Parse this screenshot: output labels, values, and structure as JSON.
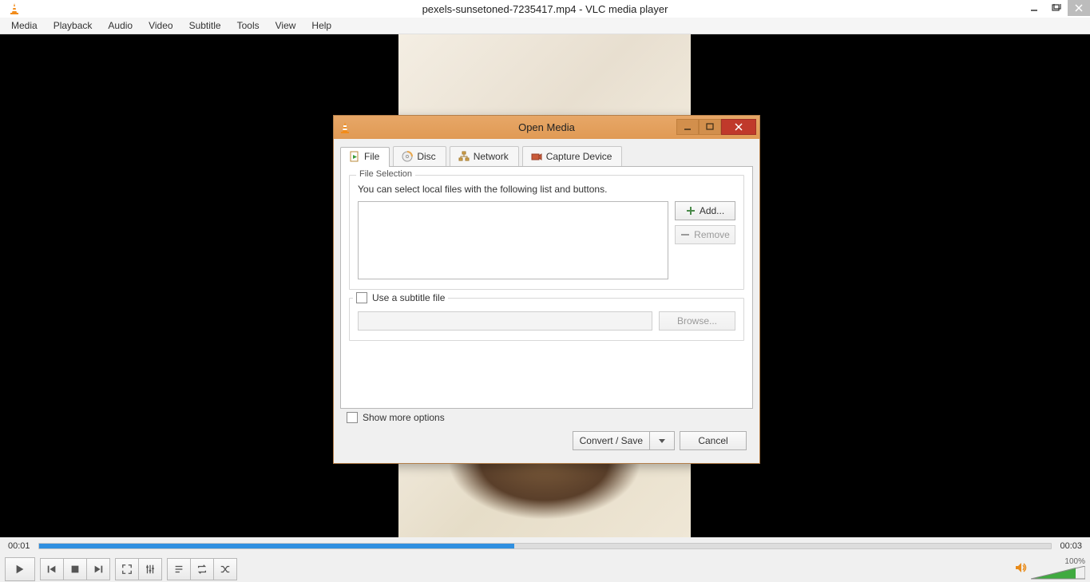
{
  "window": {
    "title": "pexels-sunsetoned-7235417.mp4 - VLC media player"
  },
  "menubar": {
    "items": [
      "Media",
      "Playback",
      "Audio",
      "Video",
      "Subtitle",
      "Tools",
      "View",
      "Help"
    ]
  },
  "playback": {
    "time_current": "00:01",
    "time_total": "00:03",
    "volume_percent": "100%"
  },
  "dialog": {
    "title": "Open Media",
    "tabs": {
      "file": "File",
      "disc": "Disc",
      "network": "Network",
      "capture": "Capture Device"
    },
    "file_group": {
      "legend": "File Selection",
      "help": "You can select local files with the following list and buttons.",
      "add": "Add...",
      "remove": "Remove"
    },
    "subtitle": {
      "checkbox": "Use a subtitle file",
      "browse": "Browse..."
    },
    "show_more": "Show more options",
    "convert": "Convert / Save",
    "cancel": "Cancel"
  }
}
